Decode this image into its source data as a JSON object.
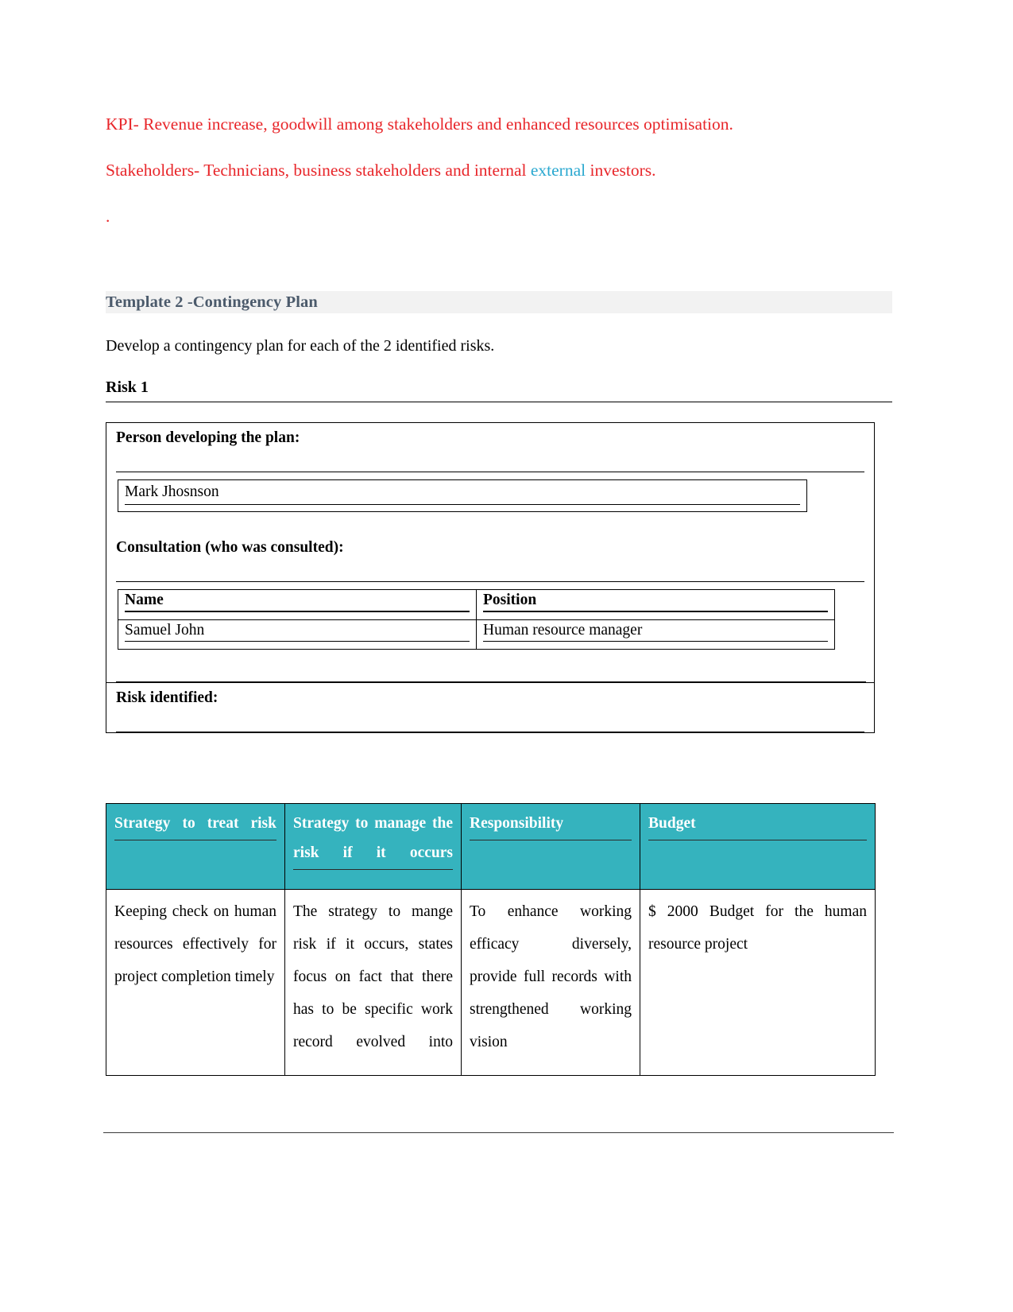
{
  "document": {
    "intro": {
      "kpi_line": "KPI- Revenue increase, goodwill among stakeholders and enhanced resources optimisation.",
      "stakeholders_prefix": "Stakeholders- Technicians, business stakeholders and internal ",
      "stakeholders_highlight": "external",
      "stakeholders_suffix": " investors.",
      "trailing_dot": "."
    },
    "template_banner": {
      "title": "Template 2 -Contingency Plan"
    },
    "instruction": "Develop a contingency plan for each of the 2 identified risks.",
    "risk_heading": "Risk 1",
    "form": {
      "person_label_bold": "Person developing the plan",
      "person_label_colon": ":",
      "person_value": "Mark Jhosnson",
      "consultation_label": "Consultation (who was consulted):",
      "consultation_headers": [
        "Name",
        "Position"
      ],
      "consultation_rows": [
        [
          "Samuel John",
          "Human resource manager"
        ]
      ],
      "risk_identified_label_bold": "Risk identified",
      "risk_identified_colon": ":",
      "risk_identified_value": ""
    },
    "strategy_table": {
      "headers": [
        "Strategy to treat risk",
        "Strategy to manage the risk if it occurs",
        "Responsibility",
        "Budget"
      ],
      "rows": [
        [
          "Keeping check on human resources effectively for project completion timely",
          "The strategy to mange risk if it occurs, states focus on fact that there has to be specific work record evolved into",
          "To enhance working efficacy diversely, provide full records with strengthened working vision",
          "$ 2000 Budget for the human resource project"
        ]
      ]
    },
    "colors": {
      "red_text": "#e8262a",
      "cyan_text": "#2aa8d0",
      "banner_text": "#4b5a6b",
      "banner_background": "#f2f2f2",
      "table_header_teal": "#35b3be",
      "table_header_text": "#ffffff",
      "body_text": "#000000"
    }
  }
}
